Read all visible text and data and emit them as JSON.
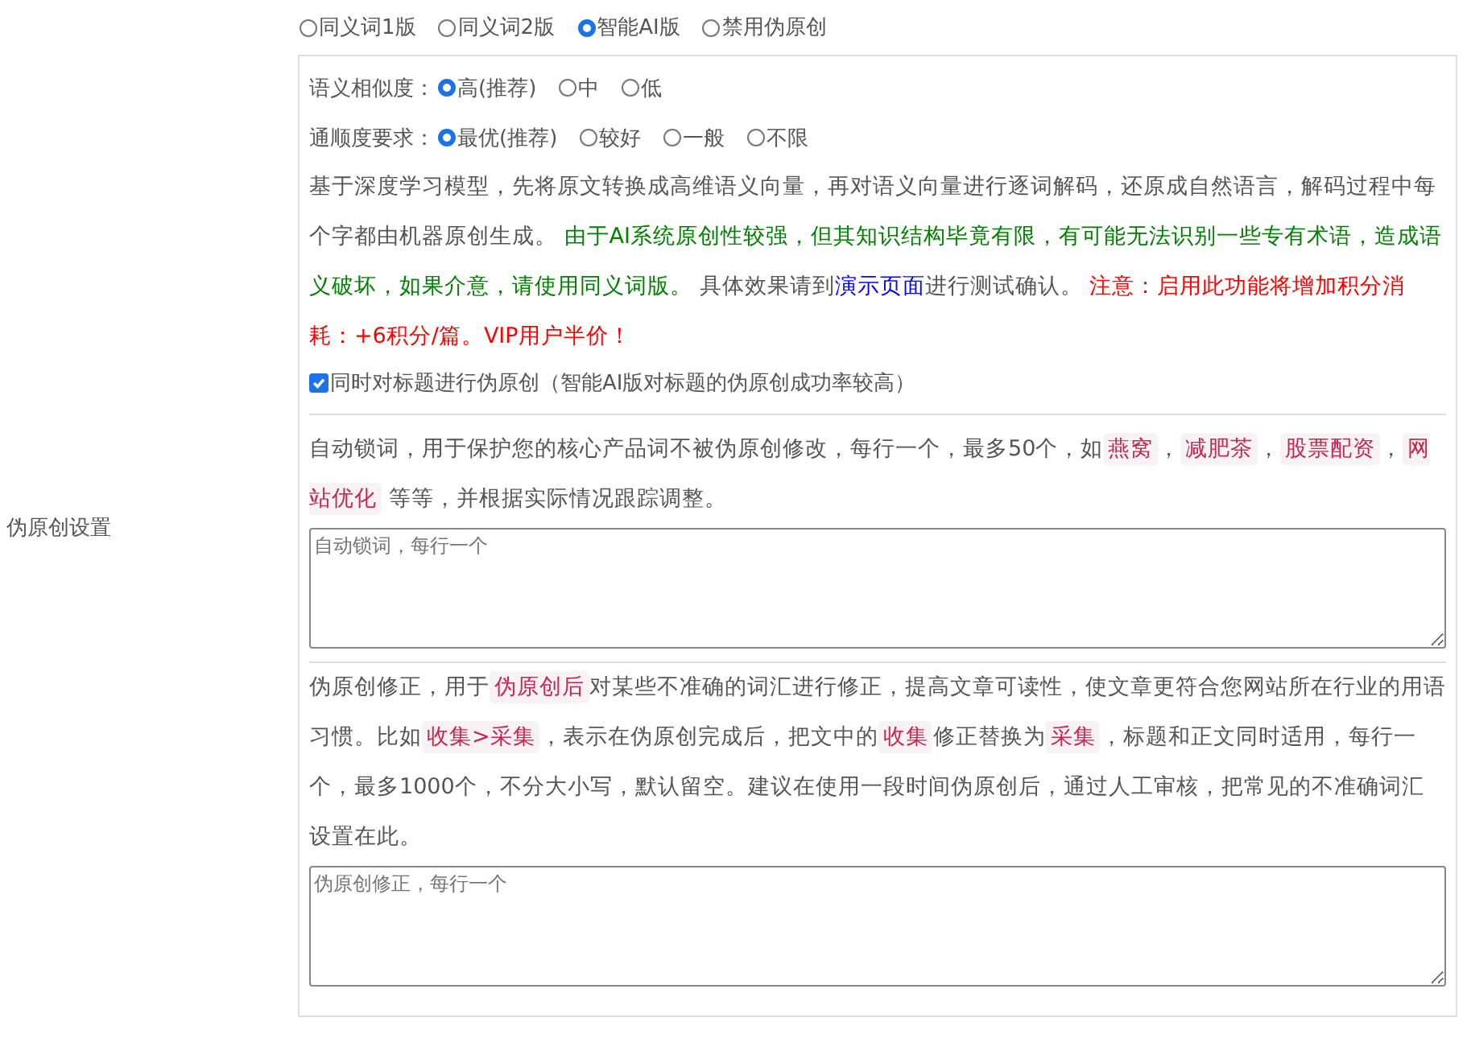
{
  "section_label": "伪原创设置",
  "modes": [
    {
      "label": "同义词1版",
      "selected": false
    },
    {
      "label": "同义词2版",
      "selected": false
    },
    {
      "label": "智能AI版",
      "selected": true
    },
    {
      "label": "禁用伪原创",
      "selected": false
    }
  ],
  "similarity": {
    "label": "语义相似度：",
    "options": [
      {
        "label": "高(推荐)",
        "selected": true
      },
      {
        "label": "中",
        "selected": false
      },
      {
        "label": "低",
        "selected": false
      }
    ]
  },
  "fluency": {
    "label": "通顺度要求：",
    "options": [
      {
        "label": "最优(推荐)",
        "selected": true
      },
      {
        "label": "较好",
        "selected": false
      },
      {
        "label": "一般",
        "selected": false
      },
      {
        "label": "不限",
        "selected": false
      }
    ]
  },
  "ai_note": [
    {
      "kind": "text",
      "text": "基于深度学习模型，先将原文转换成高维语义向量，再对语义向量进行逐词解码，还原成自然语言，解码过程中每个字都由机器原创生成。 "
    },
    {
      "kind": "note",
      "text": "由于AI系统原创性较强，但其知识结构毕竟有限，有可能无法识别一些专有术语，造成语义破坏，如果介意，请使用同义词版。"
    },
    {
      "kind": "text",
      "text": " 具体效果请到"
    },
    {
      "kind": "link",
      "text": "演示页面"
    },
    {
      "kind": "text",
      "text": "进行测试确认。 "
    },
    {
      "kind": "warning",
      "text": "注意：启用此功能将增加积分消耗：+6积分/篇。VIP用户半价！"
    }
  ],
  "title_option": {
    "label": "同时对标题进行伪原创（智能AI版对标题的伪原创成功率较高）",
    "checked": true
  },
  "lock_words": {
    "description": [
      {
        "kind": "text",
        "text": "自动锁词，用于保护您的核心产品词不被伪原创修改，每行一个，最多50个，如"
      },
      {
        "kind": "code",
        "text": "燕窝"
      },
      {
        "kind": "text",
        "text": "，"
      },
      {
        "kind": "code",
        "text": "减肥茶"
      },
      {
        "kind": "text",
        "text": "，"
      },
      {
        "kind": "code",
        "text": "股票配资"
      },
      {
        "kind": "text",
        "text": "，"
      },
      {
        "kind": "code",
        "text": "网站优化"
      },
      {
        "kind": "text",
        "text": " 等等，并根据实际情况跟踪调整。"
      }
    ],
    "placeholder": "自动锁词，每行一个"
  },
  "corrections": {
    "description": [
      {
        "kind": "text",
        "text": "伪原创修正，用于"
      },
      {
        "kind": "code",
        "text": "伪原创后"
      },
      {
        "kind": "text",
        "text": "对某些不准确的词汇进行修正，提高文章可读性，使文章更符合您网站所在行业的用语习惯。比如"
      },
      {
        "kind": "code",
        "text": "收集>采集"
      },
      {
        "kind": "text",
        "text": "，表示在伪原创完成后，把文中的"
      },
      {
        "kind": "code",
        "text": "收集"
      },
      {
        "kind": "text",
        "text": "修正替换为"
      },
      {
        "kind": "code",
        "text": "采集"
      },
      {
        "kind": "text",
        "text": "，标题和正文同时适用，每行一个，最多1000个，不分大小写，默认留空。建议在使用一段时间伪原创后，通过人工审核，把常见的不准确词汇设置在此。"
      }
    ],
    "placeholder": "伪原创修正，每行一个"
  }
}
